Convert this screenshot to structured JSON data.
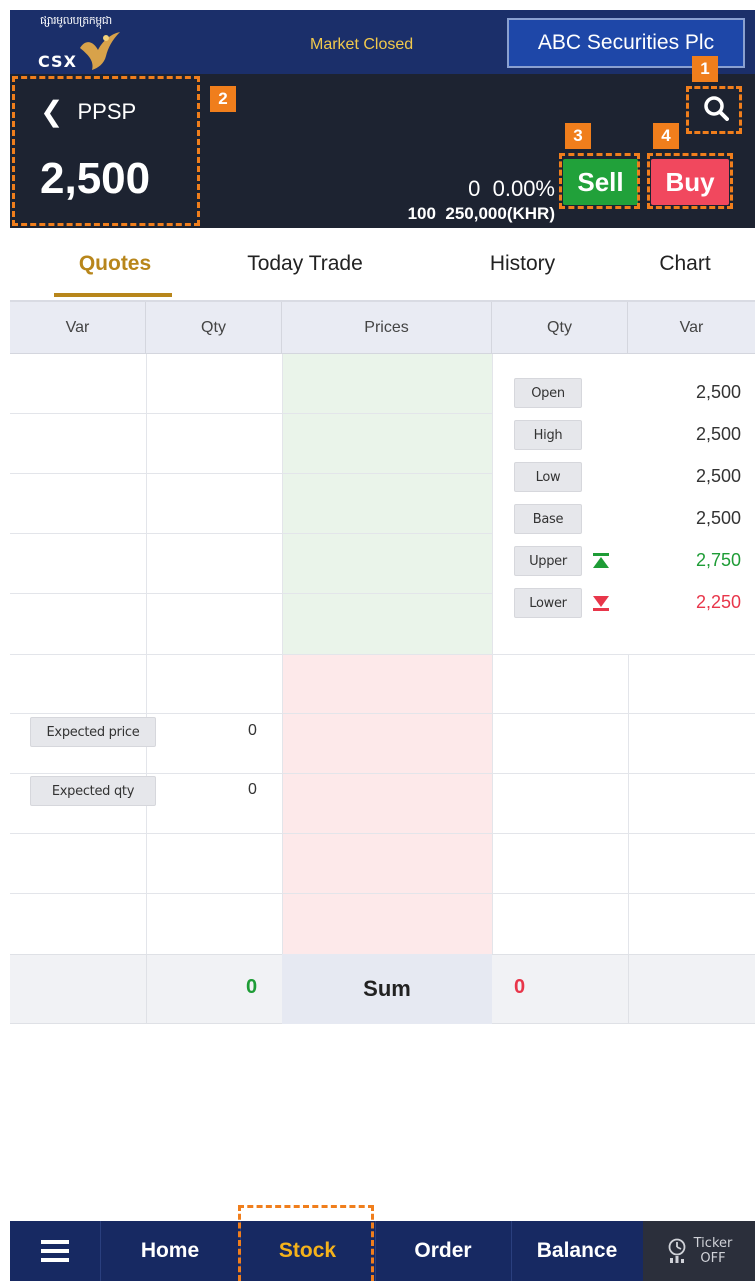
{
  "header": {
    "logo_khmer": "ផ្សារមូលបត្រកម្ពុជា",
    "logo_text": "CSX",
    "market_status": "Market Closed",
    "broker_name": "ABC Securities Plc"
  },
  "stock": {
    "symbol": "PPSP",
    "last_price": "2,500",
    "change": "0",
    "change_pct": "0.00%",
    "volume": "100",
    "value": "250,000(KHR)",
    "sell_label": "Sell",
    "buy_label": "Buy"
  },
  "annotations": {
    "search": "1",
    "stock_info": "2",
    "sell": "3",
    "buy": "4"
  },
  "tabs": [
    {
      "label": "Quotes"
    },
    {
      "label": "Today Trade"
    },
    {
      "label": "History"
    },
    {
      "label": "Chart"
    }
  ],
  "orderbook": {
    "columns": [
      "Var",
      "Qty",
      "Prices",
      "Qty",
      "Var"
    ],
    "info": [
      {
        "label": "Open",
        "value": "2,500"
      },
      {
        "label": "High",
        "value": "2,500"
      },
      {
        "label": "Low",
        "value": "2,500"
      },
      {
        "label": "Base",
        "value": "2,500"
      },
      {
        "label": "Upper",
        "value": "2,750"
      },
      {
        "label": "Lower",
        "value": "2,250"
      }
    ],
    "expected": [
      {
        "label": "Expected price",
        "value": "0"
      },
      {
        "label": "Expected qty",
        "value": "0"
      }
    ],
    "sum": {
      "label": "Sum",
      "bid_qty": "0",
      "ask_qty": "0"
    }
  },
  "colors": {
    "up": "#1e9c36",
    "down": "#e8364a",
    "accent": "#b8861b",
    "annotation": "#f07e1c"
  },
  "nav": {
    "home": "Home",
    "stock": "Stock",
    "order": "Order",
    "balance": "Balance",
    "ticker_line1": "Ticker",
    "ticker_line2": "OFF"
  }
}
